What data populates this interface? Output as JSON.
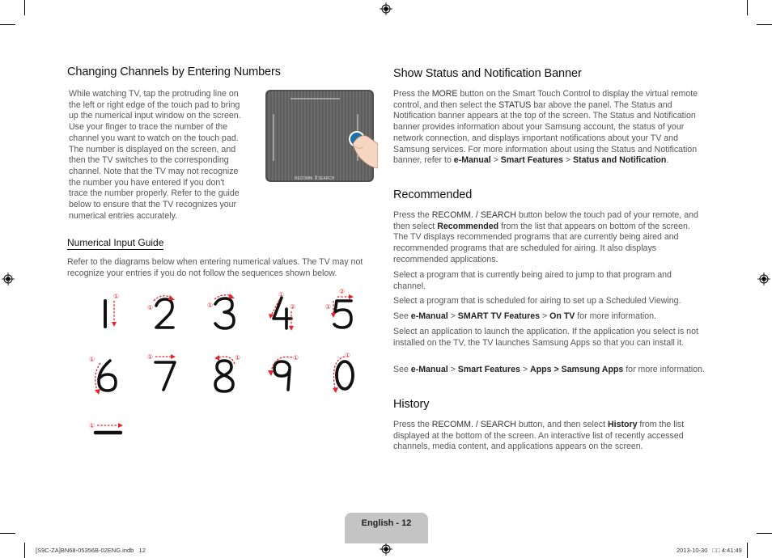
{
  "left": {
    "heading": "Changing Channels by Entering Numbers",
    "intro": "While watching TV, tap the protruding line on the left or right edge of the touch pad to bring up the numerical input window on the screen. Use your finger to trace the number of the channel you want to watch on the touch pad. The number is displayed on the screen, and then the TV switches to the corresponding channel. Note that the TV may not recognize the number you have entered if you don't trace the number properly. Refer to the guide below to ensure that the TV recognizes your numerical entries accurately.",
    "intro_lines": [
      "While watching TV, tap the protruding line on",
      "the left or right edge of the touch pad to bring",
      "up the numerical input window on the screen.",
      "Use your finger to trace the number of the",
      "channel you want to watch on the touch pad.",
      "The number is displayed on the screen, and",
      "then the TV switches to the corresponding",
      "channel. Note that the TV may not recognize",
      "the number you have entered if you don't",
      "trace the number properly. Refer to the guide",
      "below to ensure that the TV recognizes your",
      "numerical entries accurately."
    ],
    "touchpad_label_left": "RECOMM.",
    "touchpad_label_right": "SEARCH",
    "guide_heading": "Numerical Input Guide",
    "guide_text": "Refer to the diagrams below when entering numerical values. The TV may not recognize your entries if you do not follow the sequences shown below.",
    "guide_lines": [
      "Refer to the diagrams below when entering numerical values. The TV may not",
      "recognize your entries if you do not follow the sequences shown below."
    ],
    "digits": [
      "1",
      "2",
      "3",
      "4",
      "5",
      "6",
      "7",
      "8",
      "9",
      "0",
      "–"
    ],
    "step_marks": [
      "①",
      "②"
    ],
    "stroke_color": "#e8232b"
  },
  "right": {
    "status": {
      "heading": "Show Status and Notification Banner",
      "p1": "Press the ",
      "more": "MORE",
      "p2": " button on the Smart Touch Control to display the virtual remote control, and then select the ",
      "status": "STATUS",
      "p3": " bar above the panel. The Status and Notification banner appears at the top of the screen. The Status and Notification banner provides information about your Samsung account, the status of your network connection, and displays important notifications about your TV and Samsung services. For more information about using the Status and Notification banner, refer to ",
      "path1": "e-Manual",
      "sep": " > ",
      "path2": "Smart Features",
      "path3": "Status and Notification",
      "end": "."
    },
    "recommended": {
      "heading": "Recommended",
      "p1a": "Press the ",
      "p1btn": "RECOMM. / SEARCH",
      "p1b": " button below the touch pad of your remote, and then select ",
      "p1sel": "Recommended",
      "p1c": " from the list that appears on bottom of the screen. The TV displays recommended programs that are currently being aired and recommended programs that are scheduled for airing. It also displays recommended applications.",
      "p2": "Select a program that is currently being aired to jump to that program and channel.",
      "p3": "Select a program that is scheduled for airing to set up a Scheduled Viewing.",
      "p4a": "See ",
      "p4b": "e-Manual",
      "p4c": " > ",
      "p4d": "SMART TV Features",
      "p4e": " > ",
      "p4f": "On TV",
      "p4g": " for more information.",
      "p5": "Select an application to launch the application. If the application you select is not installed on the TV, the TV launches Samsung Apps so that you can install it.",
      "p6a": "See ",
      "p6b": "e-Manual",
      "p6c": " > ",
      "p6d": "Smart Features",
      "p6e": " > ",
      "p6f": "Apps > Samsung Apps",
      "p6g": " for more information."
    },
    "history": {
      "heading": "History",
      "p1a": "Press the ",
      "p1btn": "RECOMM. / SEARCH",
      "p1b": " button, and then select ",
      "p1sel": "History",
      "p1c": " from the list displayed at the bottom of the screen. An interactive list of recently accessed channels, media content, and applications appears on the screen."
    }
  },
  "footer": {
    "page_label": "English - 12",
    "slug_left": "[S9C-ZA]BN68-05356B-02ENG.indb   12",
    "slug_right": "2013-10-30   □□ 4:41:49"
  }
}
